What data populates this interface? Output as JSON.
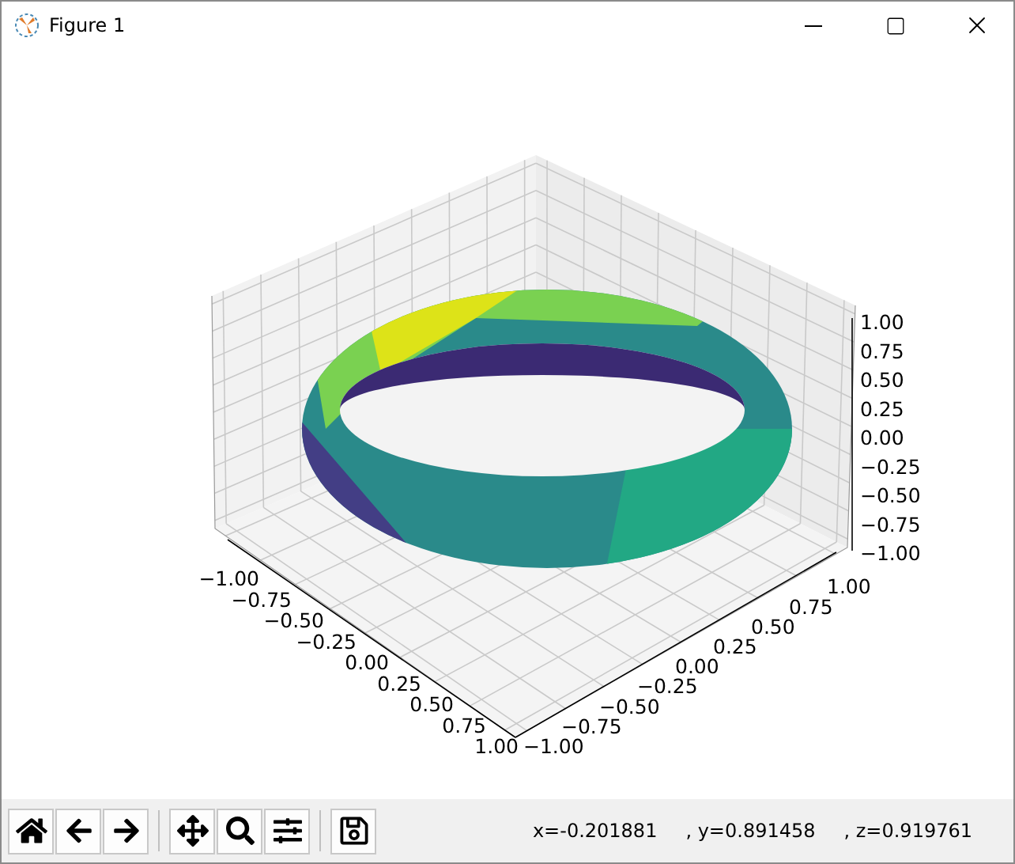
{
  "window": {
    "title": "Figure 1"
  },
  "axes": {
    "x_ticks": [
      "−1.00",
      "−0.75",
      "−0.50",
      "−0.25",
      "0.00",
      "0.25",
      "0.50",
      "0.75",
      "1.00"
    ],
    "y_ticks": [
      "−1.00",
      "−0.75",
      "−0.50",
      "−0.25",
      "0.00",
      "0.25",
      "0.50",
      "0.75",
      "1.00"
    ],
    "z_ticks": [
      "1.00",
      "0.75",
      "0.50",
      "0.25",
      "0.00",
      "−0.25",
      "−0.50",
      "−0.75",
      "−1.00"
    ]
  },
  "toolbar": {
    "groups": [
      [
        {
          "kind": "home"
        },
        {
          "kind": "back"
        },
        {
          "kind": "forward"
        }
      ],
      [
        {
          "kind": "pan"
        },
        {
          "kind": "zoom"
        },
        {
          "kind": "configure"
        }
      ],
      [
        {
          "kind": "save"
        }
      ]
    ]
  },
  "status": [
    "x=-0.201881",
    ", y=0.891458",
    ", z=0.919761"
  ]
}
